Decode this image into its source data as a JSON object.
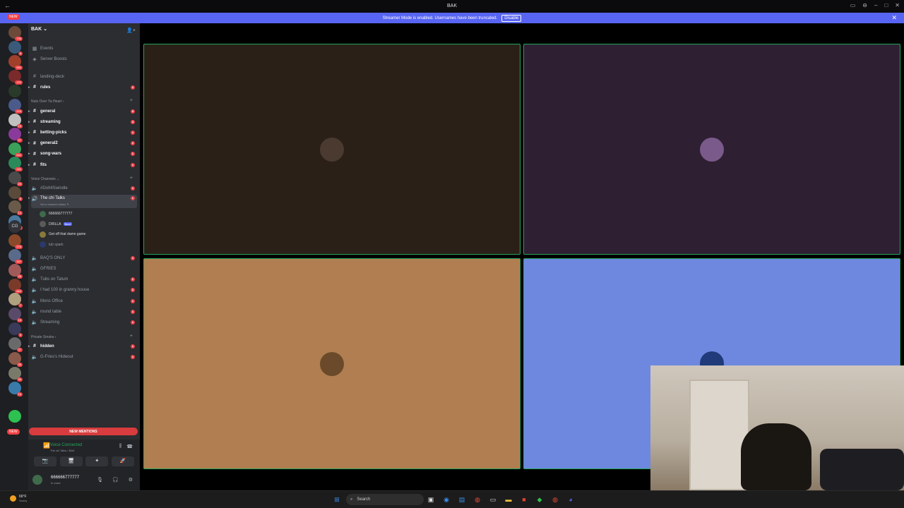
{
  "window": {
    "title": "BAK",
    "back": "←",
    "forward": "→",
    "controls": [
      "▭",
      "⊖",
      "–",
      "□",
      "✕"
    ]
  },
  "banner": {
    "text": "Streamer Mode is enabled. Usernames have been truncated.",
    "button": "Disable",
    "close": "✕"
  },
  "rail": {
    "new_top": "NEW",
    "new_bottom": "NEW",
    "cg_label": "CG",
    "servers": [
      {
        "color": "#6b4a3a",
        "badge": "736"
      },
      {
        "color": "#3a5a7a",
        "badge": "8"
      },
      {
        "color": "#a0402a",
        "badge": "952"
      },
      {
        "color": "#7a2a2a",
        "badge": "122"
      },
      {
        "color": "#2a3a2a",
        "badge": ""
      },
      {
        "color": "#4a5a8a",
        "badge": "203"
      },
      {
        "color": "#c0c0c0",
        "badge": "15"
      },
      {
        "color": "#8a3a9a",
        "badge": "47"
      },
      {
        "color": "#3aa05a",
        "badge": "641"
      },
      {
        "color": "#2a8a5a",
        "badge": "181"
      },
      {
        "color": "#4a4a4a",
        "badge": "29"
      },
      {
        "color": "#5a4a3a",
        "badge": "8"
      },
      {
        "color": "#6a5a4a",
        "badge": "13"
      },
      {
        "color": "#4a7aa0",
        "badge": "514"
      },
      {
        "color": "#8a4a2a",
        "badge": "278"
      },
      {
        "color": "#5a6a8a",
        "badge": "167"
      },
      {
        "color": "#a05a5a",
        "badge": "28"
      },
      {
        "color": "#7a3a2a",
        "badge": "662"
      },
      {
        "color": "#b0a080",
        "badge": "7"
      },
      {
        "color": "#5a4a6a",
        "badge": "15"
      },
      {
        "color": "#3a3a5a",
        "badge": "9"
      },
      {
        "color": "#6a6a6a",
        "badge": "37"
      },
      {
        "color": "#8a5a4a",
        "badge": "35"
      },
      {
        "color": "#7a7a6a",
        "badge": "35"
      },
      {
        "color": "#3a7aaa",
        "badge": "15"
      },
      {
        "color": "#2ec050",
        "badge": ""
      }
    ]
  },
  "sidebar": {
    "guild_name": "BAK ⌄",
    "guild_icon": "👤+",
    "events": "Events",
    "boosts": "Server Boosts",
    "channels_top": [
      {
        "name": "landing-deck",
        "unread": false,
        "count": ""
      },
      {
        "name": "rules",
        "unread": true,
        "count": "2"
      }
    ],
    "cat1": "Nuts Over Ya Heart ›",
    "channels_mid": [
      {
        "name": "general",
        "count": "9"
      },
      {
        "name": "streaming",
        "count": "3"
      },
      {
        "name": "betting-picks",
        "count": "1"
      },
      {
        "name": "general2",
        "count": "2"
      },
      {
        "name": "song-wars",
        "count": "1"
      },
      {
        "name": "fits",
        "count": "1"
      }
    ],
    "cat2": "Voice Channels ⌄",
    "voice_top": {
      "name": "#DoIt4Swindle",
      "count": "1"
    },
    "active": {
      "name": "The chi Talks",
      "status": "Set a channel status ✎",
      "count": "1"
    },
    "voice_users": [
      {
        "name": "666666777777",
        "color": "#3f6b4a",
        "boost": ""
      },
      {
        "name": "DRILLA",
        "color": "#5a5a5a",
        "boost": "Boot"
      },
      {
        "name": "Get off that damn game",
        "color": "#8a7a3a",
        "boost": ""
      },
      {
        "name": "tub spark",
        "color": "#2a3a6a",
        "boost": ""
      }
    ],
    "voice_more": [
      {
        "name": "BAQ'S ONLY",
        "count": "1"
      },
      {
        "name": "GFRIES",
        "count": ""
      },
      {
        "name": "Tubs on Tatum",
        "count": "1"
      },
      {
        "name": "I had 100 in granny house",
        "count": "1"
      },
      {
        "name": "Mons Office",
        "count": "1"
      },
      {
        "name": "round table",
        "count": "1"
      },
      {
        "name": "Streaming",
        "count": "1"
      }
    ],
    "cat3": "Private Smoke ›",
    "private": [
      {
        "name": "hidden",
        "count": "1",
        "voice": false
      },
      {
        "name": "G-Fries's Hideout",
        "count": "1",
        "voice": true
      }
    ],
    "new_mentions": "NEW MENTIONS"
  },
  "voice_panel": {
    "title": "Voice Connected",
    "sub": "The chi Talks / BAK",
    "buttons": [
      "📷",
      "🖥",
      "✦",
      "🚀"
    ]
  },
  "user_panel": {
    "name": "666666777777",
    "status": "In voice"
  },
  "tiles": [
    {
      "bg": "#2b2018",
      "face": "#4a3a30"
    },
    {
      "bg": "#2e1f33",
      "face": "#7a5a8a"
    },
    {
      "bg": "#b07e50",
      "face": "#6a4a2a"
    },
    {
      "bg": "#6e88e0",
      "face": "#203a7a"
    }
  ],
  "taskbar": {
    "temp": "66°F",
    "condition": "Sunny",
    "search": "Search"
  }
}
